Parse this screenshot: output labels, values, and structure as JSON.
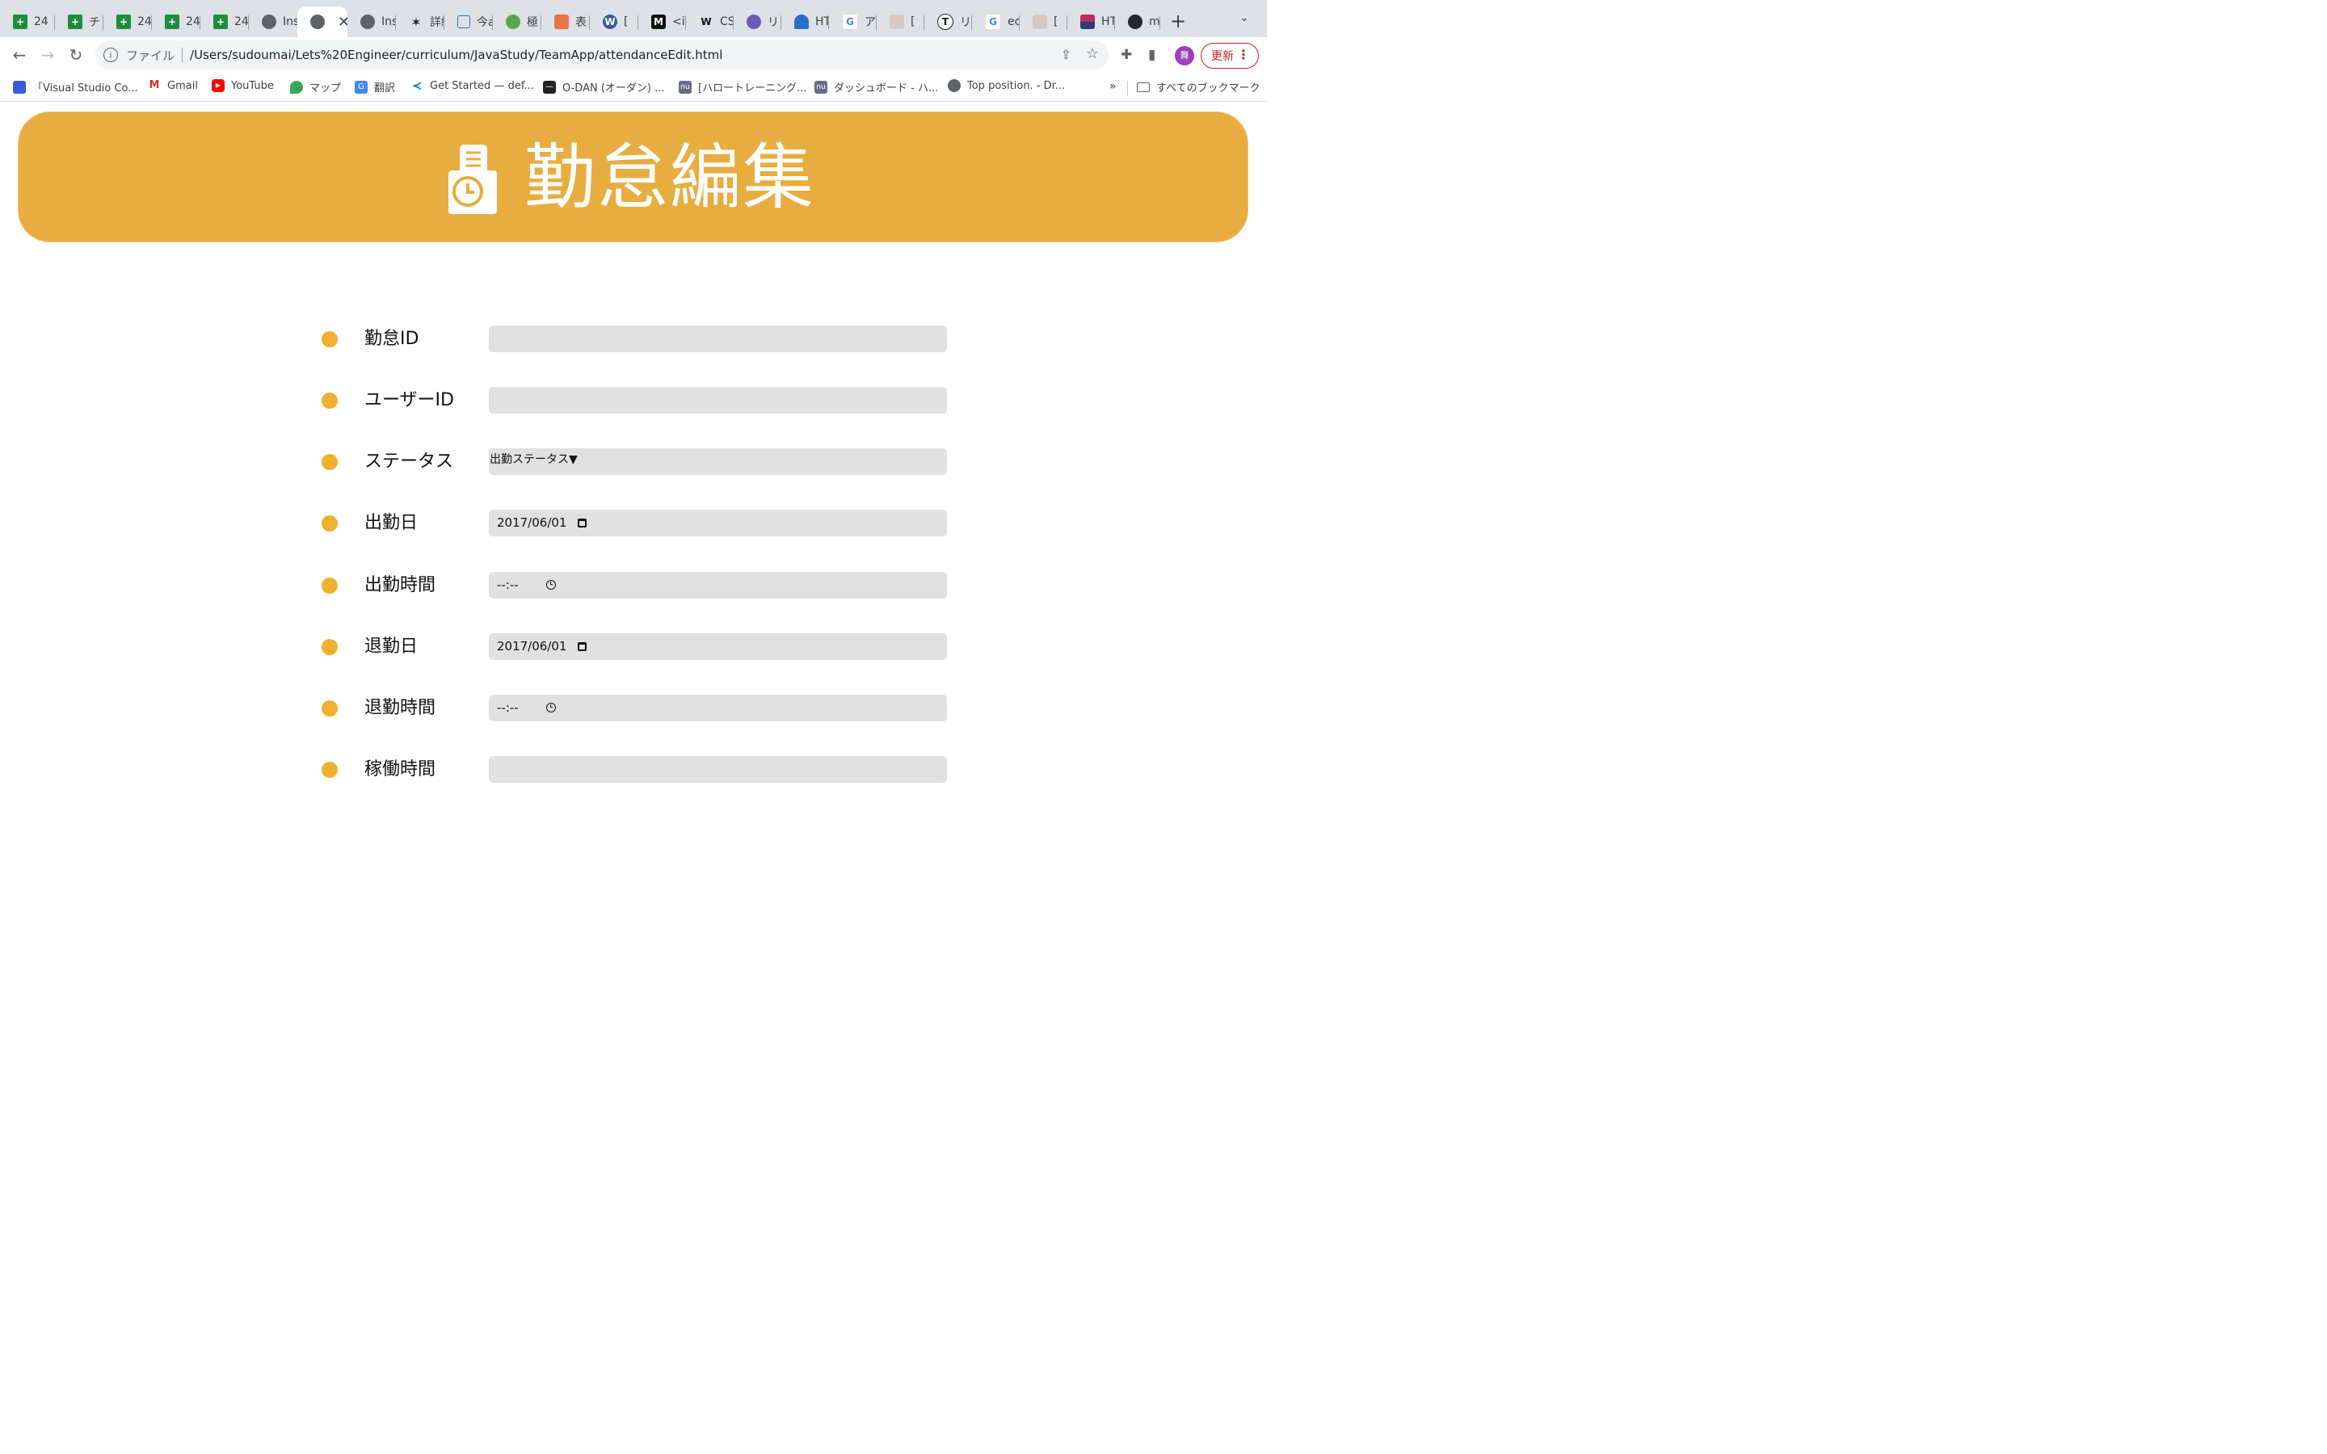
{
  "browser": {
    "tabs": [
      {
        "label": "24",
        "icon": "sheets-icon"
      },
      {
        "label": "チ",
        "icon": "sheets-icon"
      },
      {
        "label": "24",
        "icon": "sheets-icon"
      },
      {
        "label": "24",
        "icon": "sheets-icon"
      },
      {
        "label": "24",
        "icon": "sheets-icon"
      },
      {
        "label": "Ins",
        "icon": "globe-icon"
      },
      {
        "label": "",
        "icon": "globe-icon",
        "active": true
      },
      {
        "label": "Ins",
        "icon": "globe-icon"
      },
      {
        "label": "詳細",
        "icon": "asterisk-icon"
      },
      {
        "label": "今a",
        "icon": "box-icon"
      },
      {
        "label": "極",
        "icon": "green-circle-icon"
      },
      {
        "label": "表",
        "icon": "orange-square-icon"
      },
      {
        "label": "[",
        "icon": "wordpress-icon"
      },
      {
        "label": "<ir",
        "icon": "m-logo-icon"
      },
      {
        "label": "CS",
        "icon": "w-logo-icon"
      },
      {
        "label": "リ",
        "icon": "cat-icon"
      },
      {
        "label": "HT",
        "icon": "blue-cap-icon"
      },
      {
        "label": "ア",
        "icon": "google-icon"
      },
      {
        "label": "[",
        "icon": "anime-icon"
      },
      {
        "label": "リ",
        "icon": "t-circle-icon"
      },
      {
        "label": "ec",
        "icon": "google-icon"
      },
      {
        "label": "[",
        "icon": "anime-icon"
      },
      {
        "label": "HT",
        "icon": "flag-icon"
      },
      {
        "label": "mi",
        "icon": "github-icon"
      }
    ],
    "new_tab_symbol": "+",
    "tab_menu_symbol": "⌄",
    "address": {
      "scheme_label": "ファイル",
      "url": "/Users/sudoumai/Lets%20Engineer/curriculum/JavaStudy/TeamApp/attendanceEdit.html"
    },
    "profile_initial": "舞",
    "update_label": "更新",
    "bookmarks": [
      {
        "label": "「Visual Studio Co...",
        "color": "#3a5bd9"
      },
      {
        "label": "Gmail",
        "color": "#d93025"
      },
      {
        "label": "YouTube",
        "color": "#ff0000"
      },
      {
        "label": "マップ",
        "color": "#34a853"
      },
      {
        "label": "翻訳",
        "color": "#4285f4"
      },
      {
        "label": "Get Started — def...",
        "color": "#007acc"
      },
      {
        "label": "O-DAN (オーダン) ...",
        "color": "#222222"
      },
      {
        "label": "[ハロートレーニング...",
        "color": "#6b6b8a"
      },
      {
        "label": "ダッシュボード - ハ...",
        "color": "#6b6b8a"
      },
      {
        "label": "Top position. - Dr...",
        "color": "#5f6368"
      }
    ],
    "bookmarks_overflow": "»",
    "all_bookmarks_label": "すべてのブックマーク"
  },
  "page": {
    "header_title": "勤怠編集",
    "accent_color": "#e8ad40",
    "fields": [
      {
        "label": "勤怠ID",
        "value": "",
        "type": "text"
      },
      {
        "label": "ユーザーID",
        "value": "",
        "type": "text"
      },
      {
        "label": "ステータス",
        "value": "出勤ステータス▼",
        "type": "select"
      },
      {
        "label": "出勤日",
        "value": "2017/06/01",
        "type": "date"
      },
      {
        "label": "出勤時間",
        "value": "--:--",
        "type": "time"
      },
      {
        "label": "退勤日",
        "value": "2017/06/01",
        "type": "date"
      },
      {
        "label": "退勤時間",
        "value": "--:--",
        "type": "time"
      },
      {
        "label": "稼働時間",
        "value": "",
        "type": "text"
      }
    ]
  }
}
